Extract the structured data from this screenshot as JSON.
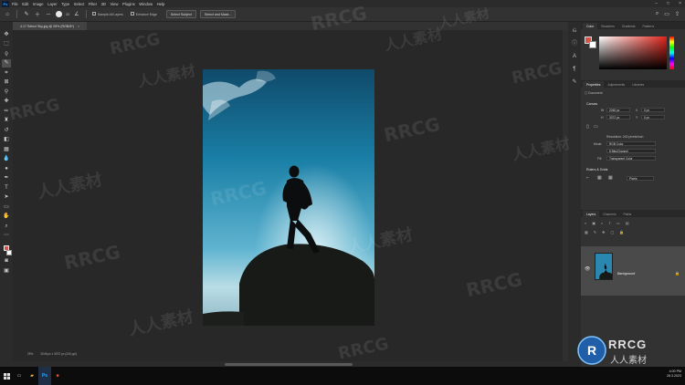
{
  "app": {
    "logo": "Ps",
    "menu": [
      "File",
      "Edit",
      "Image",
      "Layer",
      "Type",
      "Select",
      "Filter",
      "3D",
      "View",
      "Plugins",
      "Window",
      "Help"
    ]
  },
  "options_bar": {
    "brush_size": "30",
    "sample_all_layers": "Sample All Layers",
    "enhance_edge": "Enhance Edge",
    "select_subject": "Select Subject",
    "select_and_mask": "Select and Mask..."
  },
  "document": {
    "tab_title": "4.17 Select Sky.jpg @ 25% (RGB/8*)",
    "zoom": "25%",
    "doc_info": "2048 px x 3072 px (240 ppi)"
  },
  "panels": {
    "color_tabs": [
      "Color",
      "Swatches",
      "Gradients",
      "Patterns"
    ],
    "props_tabs": [
      "Properties",
      "Adjustments",
      "Libraries"
    ],
    "props_document": "Document",
    "canvas_header": "Canvas",
    "width_value": "2048 px",
    "height_value": "3072 px",
    "x_value": "0 px",
    "y_value": "0 px",
    "resolution": "Resolution: 240 pixels/inch",
    "mode_label": "Mode",
    "mode_value": "RGB Color",
    "bit_depth": "8 Bits/Channel",
    "fill_label": "Fill",
    "fill_value": "Transparent Color",
    "rulers_header": "Rulers & Grids",
    "units_value": "Pixels",
    "layers_tabs": [
      "Layers",
      "Channels",
      "Paths"
    ],
    "layer_name": "Background"
  },
  "taskbar": {
    "time": "4:00 PM",
    "date": "28.3.2023"
  },
  "watermarks": {
    "text_latin": "RRCG",
    "text_cn": "人人素材",
    "badge_latin": "RRCG",
    "badge_cn": "人人素材"
  },
  "colors": {
    "foreground": "#d4564a",
    "background": "#ffffff",
    "accent": "#31a8ff"
  }
}
